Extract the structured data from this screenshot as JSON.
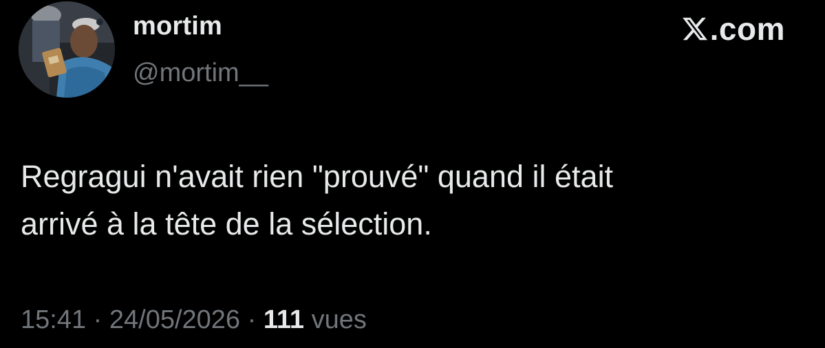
{
  "author": {
    "display_name": "mortim",
    "handle": "@mortim__",
    "avatar_icon": "profile-photo"
  },
  "brand": {
    "logo_icon": "x-logo-icon",
    "text": ".com"
  },
  "tweet": {
    "text_line1": "Regragui n'avait rien \"prouvé\" quand il était",
    "text_line2": "arrivé à la tête de la sélection."
  },
  "meta": {
    "time": "15:41",
    "separator": " · ",
    "date": "24/05/2026",
    "views_count": "111",
    "views_label": "vues"
  },
  "colors": {
    "background": "#000000",
    "primary_text": "#e7e9ea",
    "secondary_text": "#71767b"
  }
}
